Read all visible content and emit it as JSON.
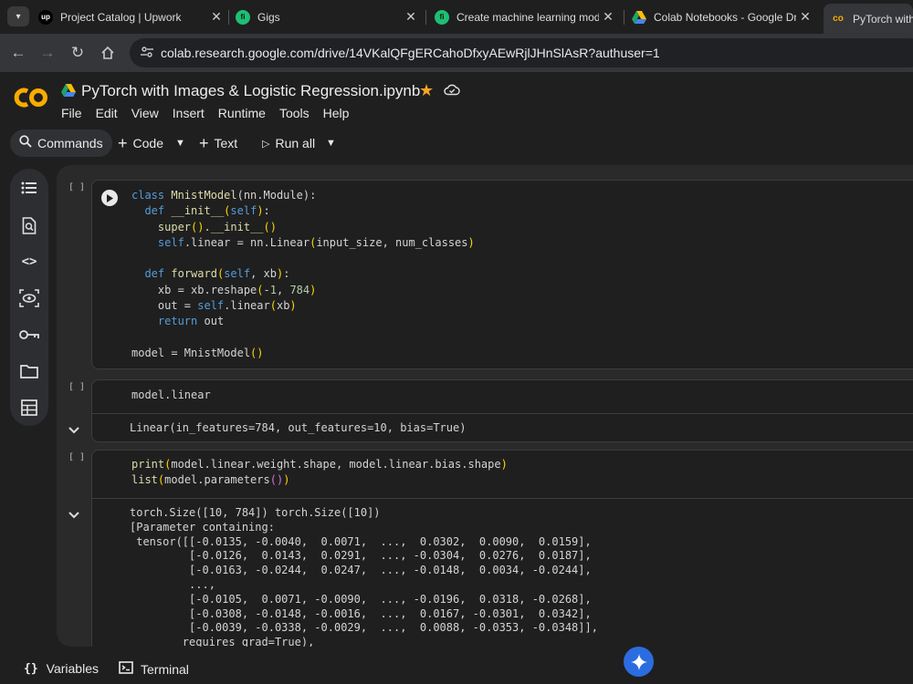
{
  "browser": {
    "tabs": [
      {
        "title": "Project Catalog | Upwork",
        "favicon": "upwork-icon",
        "favicon_text": "up"
      },
      {
        "title": "Gigs",
        "favicon": "fiverr-icon",
        "favicon_text": "fi"
      },
      {
        "title": "Create machine learning model",
        "favicon": "fiverr-icon",
        "favicon_text": "fi"
      },
      {
        "title": "Colab Notebooks - Google Drive",
        "favicon": "google-drive-icon",
        "favicon_text": ""
      },
      {
        "title": "PyTorch with Im",
        "favicon": "colab-icon",
        "favicon_text": "co",
        "active": true
      }
    ],
    "url": "colab.research.google.com/drive/14VKalQFgERCahoDfxyAEwRjlJHnSlAsR?authuser=1"
  },
  "colab": {
    "logo_text": "CO",
    "notebook_title": "PyTorch with Images & Logistic Regression.ipynb",
    "menu": [
      "File",
      "Edit",
      "View",
      "Insert",
      "Runtime",
      "Tools",
      "Help"
    ],
    "toolbar": {
      "commands": "Commands",
      "code": "Code",
      "text": "Text",
      "run_all": "Run all"
    },
    "rail_icons": [
      "toc-icon",
      "find-icon",
      "code-snippets-icon",
      "variables-inspector-icon",
      "secrets-key-icon",
      "files-folder-icon",
      "data-table-icon"
    ]
  },
  "cells": [
    {
      "bracket": "[ ]",
      "code": [
        "class MnistModel(nn.Module):",
        "  def __init__(self):",
        "    super().__init__()",
        "    self.linear = nn.Linear(input_size, num_classes)",
        "",
        "  def forward(self, xb):",
        "    xb = xb.reshape(-1, 784)",
        "    out = self.linear(xb)",
        "    return out",
        "",
        "model = MnistModel()"
      ]
    },
    {
      "bracket": "[ ]",
      "code": [
        "model.linear"
      ],
      "output": [
        "Linear(in_features=784, out_features=10, bias=True)"
      ]
    },
    {
      "bracket": "[ ]",
      "code": [
        "print(model.linear.weight.shape, model.linear.bias.shape)",
        "list(model.parameters())"
      ],
      "output": [
        "torch.Size([10, 784]) torch.Size([10])",
        "[Parameter containing:",
        " tensor([[-0.0135, -0.0040,  0.0071,  ...,  0.0302,  0.0090,  0.0159],",
        "         [-0.0126,  0.0143,  0.0291,  ..., -0.0304,  0.0276,  0.0187],",
        "         [-0.0163, -0.0244,  0.0247,  ..., -0.0148,  0.0034, -0.0244],",
        "         ...,",
        "         [-0.0105,  0.0071, -0.0090,  ..., -0.0196,  0.0318, -0.0268],",
        "         [-0.0308, -0.0148, -0.0016,  ...,  0.0167, -0.0301,  0.0342],",
        "         [-0.0039, -0.0338, -0.0029,  ...,  0.0088, -0.0353, -0.0348]],",
        "        requires_grad=True),"
      ]
    }
  ],
  "bottom": {
    "variables": "Variables",
    "terminal": "Terminal"
  },
  "colors": {
    "accent": "#f9ab00",
    "star": "#f5a623",
    "gemini": "#2b6de0"
  }
}
